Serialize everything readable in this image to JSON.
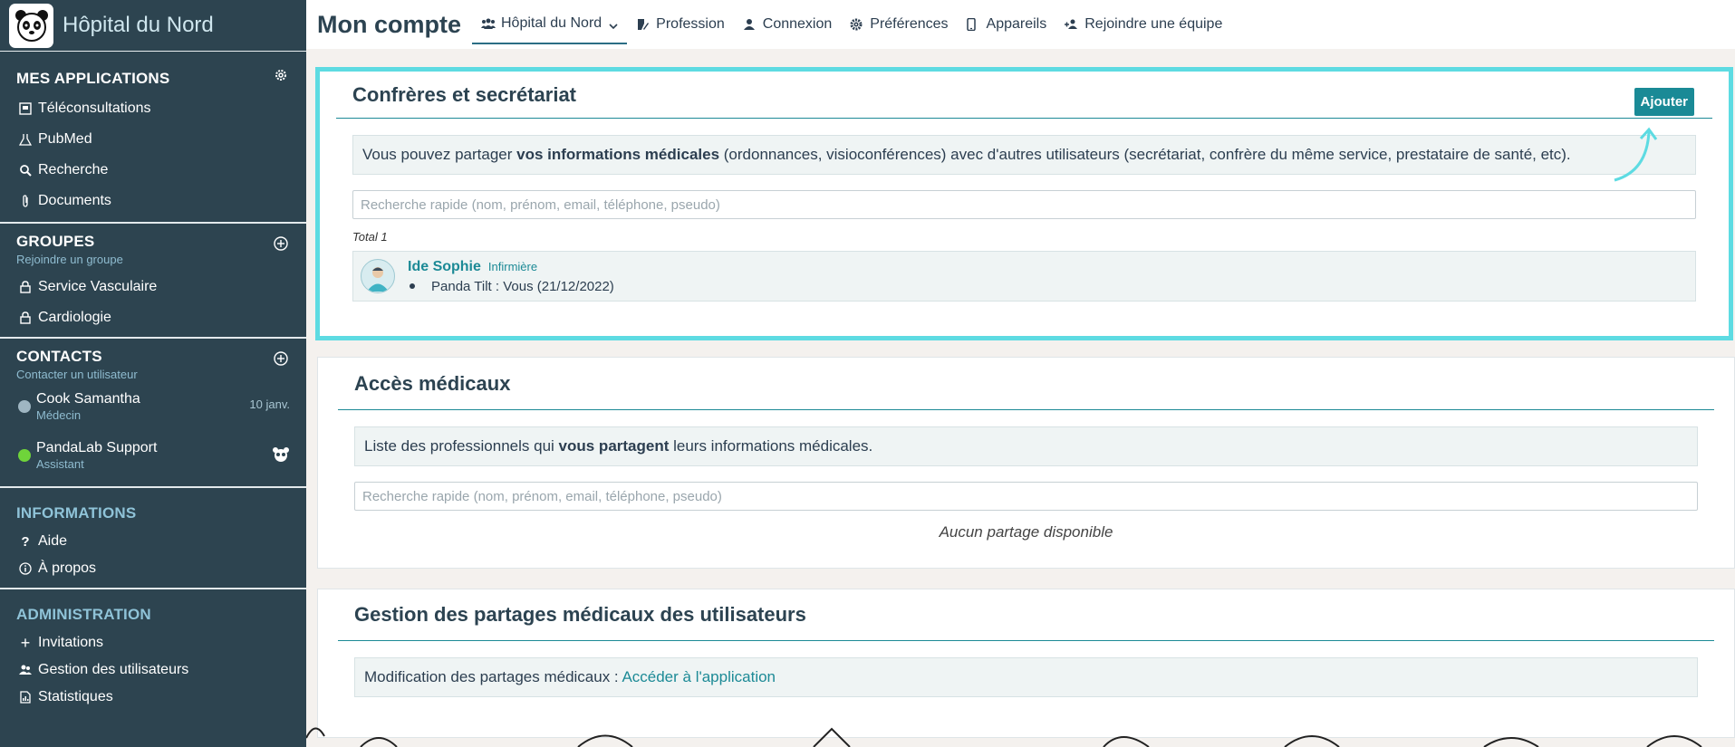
{
  "brand": {
    "name": "Hôpital du Nord"
  },
  "sidebar": {
    "apps": {
      "title": "MES APPLICATIONS",
      "items": [
        {
          "label": "Téléconsultations",
          "icon": "video-screen-icon"
        },
        {
          "label": "PubMed",
          "icon": "flask-icon"
        },
        {
          "label": "Recherche",
          "icon": "search-icon"
        },
        {
          "label": "Documents",
          "icon": "paperclip-icon"
        }
      ]
    },
    "groups": {
      "title": "GROUPES",
      "subtitle": "Rejoindre un groupe",
      "items": [
        {
          "label": "Service Vasculaire",
          "icon": "lock-icon"
        },
        {
          "label": "Cardiologie",
          "icon": "lock-icon"
        }
      ]
    },
    "contacts": {
      "title": "CONTACTS",
      "subtitle": "Contacter un utilisateur",
      "items": [
        {
          "name": "Cook Samantha",
          "role": "Médecin",
          "date": "10 janv.",
          "status_color": "#9fb6c2"
        },
        {
          "name": "PandaLab Support",
          "role": "Assistant",
          "status_color": "#6fd43a"
        }
      ]
    },
    "info": {
      "title": "INFORMATIONS",
      "items": [
        {
          "label": "Aide",
          "icon": "question-icon"
        },
        {
          "label": "À propos",
          "icon": "info-icon"
        }
      ]
    },
    "admin": {
      "title": "ADMINISTRATION",
      "items": [
        {
          "label": "Invitations",
          "icon": "plus-icon"
        },
        {
          "label": "Gestion des utilisateurs",
          "icon": "users-icon"
        },
        {
          "label": "Statistiques",
          "icon": "report-icon"
        }
      ]
    }
  },
  "header": {
    "title": "Mon compte",
    "tabs": [
      {
        "label": "Hôpital du Nord",
        "icon": "users-icon",
        "active": true
      },
      {
        "label": "Profession",
        "icon": "edit-icon"
      },
      {
        "label": "Connexion",
        "icon": "user-icon"
      },
      {
        "label": "Préférences",
        "icon": "gear-icon"
      },
      {
        "label": "Appareils",
        "icon": "mobile-icon"
      },
      {
        "label": "Rejoindre une équipe",
        "icon": "user-plus-icon"
      }
    ]
  },
  "colleagues": {
    "title": "Confrères et secrétariat",
    "add_label": "Ajouter",
    "info_before": "Vous pouvez partager ",
    "info_bold": "vos informations médicales",
    "info_after": " (ordonnances, visioconférences) avec d'autres utilisateurs (secrétariat, confrère du même service, prestataire de santé, etc).",
    "search_placeholder": "Recherche rapide (nom, prénom, email, téléphone, pseudo)",
    "total": "Total 1",
    "users": [
      {
        "name": "Ide Sophie",
        "role": "Infirmière",
        "share": "Panda Tilt : Vous (21/12/2022)"
      }
    ]
  },
  "medical_access": {
    "title": "Accès médicaux",
    "info_before": "Liste des professionnels qui ",
    "info_bold": "vous partagent",
    "info_after": " leurs informations médicales.",
    "search_placeholder": "Recherche rapide (nom, prénom, email, téléphone, pseudo)",
    "empty": "Aucun partage disponible"
  },
  "management": {
    "title": "Gestion des partages médicaux des utilisateurs",
    "info_text": "Modification des partages médicaux : ",
    "link_label": "Accéder à l'application"
  },
  "colors": {
    "sidebar_bg": "#2d4450",
    "accent": "#1a8a96",
    "highlight": "#5ddbe2"
  }
}
